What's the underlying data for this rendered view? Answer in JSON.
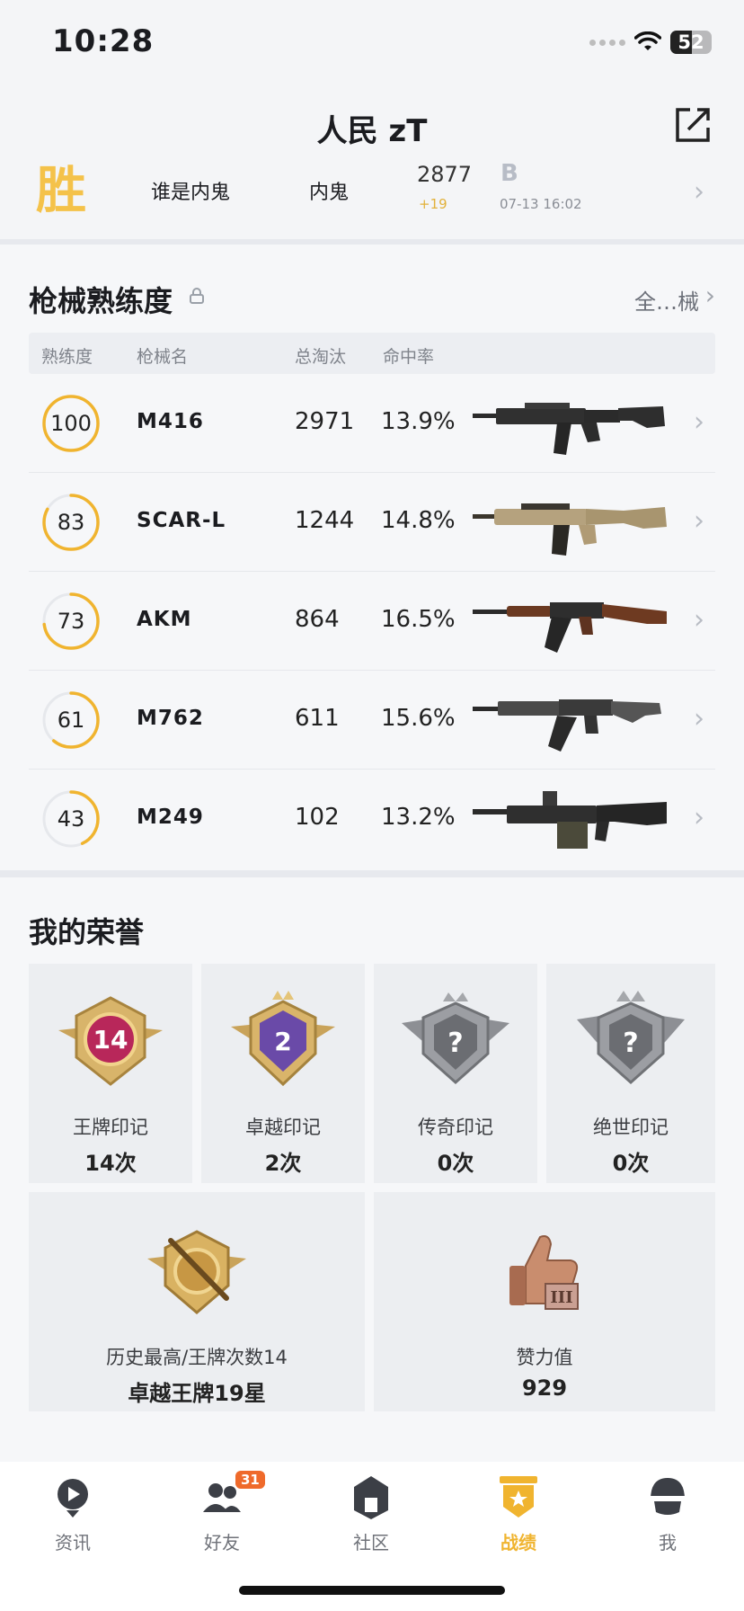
{
  "status_bar": {
    "time": "10:28",
    "battery": "52",
    "battery_level": 0.52
  },
  "header": {
    "title": "人民 zT",
    "share_icon": "share-icon"
  },
  "last_match": {
    "result": "胜",
    "mode": "谁是内鬼",
    "role": "内鬼",
    "score": "2877",
    "score_delta": "+19",
    "grade": "B",
    "time": "07-13 16:02"
  },
  "weapons": {
    "title": "枪械熟练度",
    "view_all": "全…械",
    "columns": [
      "熟练度",
      "枪械名",
      "总淘汰",
      "命中率"
    ],
    "rows": [
      {
        "proficiency": "100",
        "proficiency_level": 1.0,
        "name": "M416",
        "kills": "2971",
        "hit_rate": "13.9%"
      },
      {
        "proficiency": "83",
        "proficiency_level": 0.83,
        "name": "SCAR-L",
        "kills": "1244",
        "hit_rate": "14.8%"
      },
      {
        "proficiency": "73",
        "proficiency_level": 0.73,
        "name": "AKM",
        "kills": "864",
        "hit_rate": "16.5%"
      },
      {
        "proficiency": "61",
        "proficiency_level": 0.61,
        "name": "M762",
        "kills": "611",
        "hit_rate": "15.6%"
      },
      {
        "proficiency": "43",
        "proficiency_level": 0.43,
        "name": "M249",
        "kills": "102",
        "hit_rate": "13.2%"
      }
    ]
  },
  "honors": {
    "title": "我的荣誉",
    "marks": [
      {
        "name": "王牌印记",
        "count": "14次",
        "badge_text": "14",
        "color": "#b8275a"
      },
      {
        "name": "卓越印记",
        "count": "2次",
        "badge_text": "2",
        "color": "#6a4aa8"
      },
      {
        "name": "传奇印记",
        "count": "0次",
        "badge_text": "?",
        "color": "#6b6d72"
      },
      {
        "name": "绝世印记",
        "count": "0次",
        "badge_text": "?",
        "color": "#6b6d72"
      }
    ],
    "highest": {
      "label": "历史最高/王牌次数14",
      "value": "卓越王牌19星"
    },
    "likes": {
      "label": "赞力值",
      "value": "929"
    }
  },
  "tabs": [
    {
      "label": "资讯",
      "icon": "news-icon"
    },
    {
      "label": "好友",
      "icon": "friends-icon",
      "badge": "31"
    },
    {
      "label": "社区",
      "icon": "community-icon"
    },
    {
      "label": "战绩",
      "icon": "record-icon",
      "active": true
    },
    {
      "label": "我",
      "icon": "profile-icon"
    }
  ],
  "colors": {
    "accent": "#f0b42f",
    "win": "#f4c24a",
    "badge": "#ef6a2b"
  }
}
